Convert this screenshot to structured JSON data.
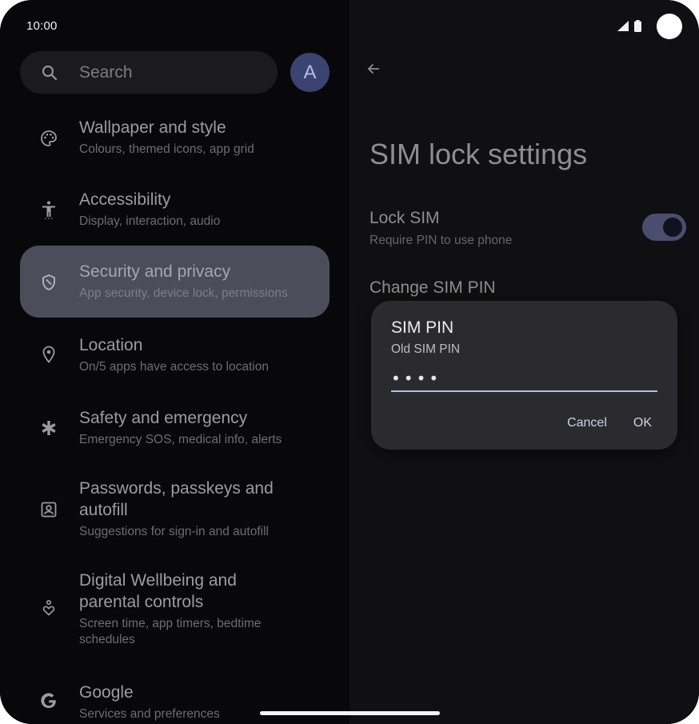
{
  "status_bar": {
    "time": "10:00",
    "icons": [
      "signal-icon",
      "battery-icon"
    ]
  },
  "search": {
    "placeholder": "Search"
  },
  "avatar": {
    "initial": "A",
    "color": "#3a4371"
  },
  "settings_list": {
    "items": [
      {
        "icon": "palette-icon",
        "title": "Wallpaper and style",
        "subtitle": "Colours, themed icons, app grid"
      },
      {
        "icon": "accessibility-icon",
        "title": "Accessibility",
        "subtitle": "Display, interaction, audio"
      },
      {
        "icon": "shield-icon",
        "title": "Security and privacy",
        "subtitle": "App security, device lock, permissions",
        "selected": true
      },
      {
        "icon": "location-pin-icon",
        "title": "Location",
        "subtitle": "On/5 apps have access to location"
      },
      {
        "icon": "asterisk-icon",
        "title": "Safety and emergency",
        "subtitle": "Emergency SOS, medical info, alerts"
      },
      {
        "icon": "account-box-icon",
        "title_line1": "Passwords, passkeys and",
        "title_line2": "autofill",
        "subtitle": "Suggestions for sign-in and autofill"
      },
      {
        "icon": "wellbeing-icon",
        "title_line1": "Digital Wellbeing and",
        "title_line2": "parental controls",
        "subtitle_line1": "Screen time, app timers, bedtime",
        "subtitle_line2": "schedules"
      },
      {
        "icon": "google-icon",
        "title": "Google",
        "subtitle": "Services and preferences"
      }
    ]
  },
  "detail": {
    "title": "SIM lock settings",
    "lock_sim": {
      "title": "Lock SIM",
      "subtitle": "Require PIN to use phone",
      "toggle_on": true
    },
    "change_pin": {
      "title": "Change SIM PIN"
    }
  },
  "dialog": {
    "title": "SIM PIN",
    "field_label": "Old SIM PIN",
    "field_value": "••••",
    "cancel_label": "Cancel",
    "ok_label": "OK"
  },
  "colors": {
    "accent": "#b8bce6",
    "selected_item": "#4d4c5a",
    "dialog_bg": "#2b2b2f"
  }
}
